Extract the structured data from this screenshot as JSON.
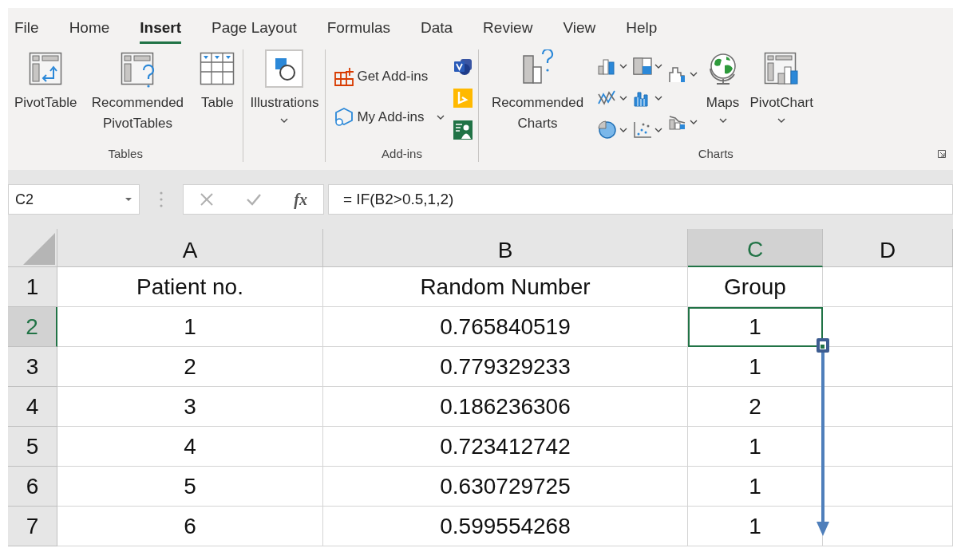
{
  "menu_tabs": [
    {
      "label": "File",
      "selected": false
    },
    {
      "label": "Home",
      "selected": false
    },
    {
      "label": "Insert",
      "selected": true
    },
    {
      "label": "Page Layout",
      "selected": false
    },
    {
      "label": "Formulas",
      "selected": false
    },
    {
      "label": "Data",
      "selected": false
    },
    {
      "label": "Review",
      "selected": false
    },
    {
      "label": "View",
      "selected": false
    },
    {
      "label": "Help",
      "selected": false
    }
  ],
  "ribbon_groups": [
    {
      "label": "Tables",
      "items": [
        {
          "kind": "large",
          "label": "PivotTable",
          "dropdown": false
        },
        {
          "kind": "large",
          "label": "Recommended PivotTables",
          "dropdown": false
        },
        {
          "kind": "large",
          "label": "Table",
          "dropdown": false
        }
      ]
    },
    {
      "items": [
        {
          "kind": "large",
          "label": "Illustrations",
          "dropdown": true
        }
      ]
    },
    {
      "label": "Add-ins",
      "items": [
        {
          "kind": "medium",
          "label": "Get Add-ins",
          "dropdown": false
        },
        {
          "kind": "medium",
          "label": "My Add-ins",
          "dropdown": true
        },
        {
          "kind": "small",
          "dropdown": false
        },
        {
          "kind": "small",
          "dropdown": false
        },
        {
          "kind": "small",
          "dropdown": false
        }
      ]
    },
    {
      "label": "Charts",
      "dialog_launcher": true,
      "items": [
        {
          "kind": "large",
          "label": "Recommended Charts",
          "dropdown": false
        },
        {
          "kind": "small",
          "dropdown": true
        },
        {
          "kind": "small",
          "dropdown": true
        },
        {
          "kind": "small",
          "dropdown": true
        },
        {
          "kind": "small",
          "dropdown": true
        },
        {
          "kind": "small",
          "dropdown": true
        },
        {
          "kind": "small",
          "dropdown": true
        },
        {
          "kind": "small",
          "dropdown": true
        },
        {
          "kind": "small",
          "dropdown": true
        },
        {
          "kind": "large",
          "label": "Maps",
          "dropdown": true
        },
        {
          "kind": "large",
          "label": "PivotChart",
          "dropdown": true
        }
      ]
    }
  ],
  "formula_bar": {
    "name_box": "C2",
    "function_button": "fx",
    "formula": "= IF(B2>0.5,1,2)"
  },
  "sheet": {
    "columns": [
      {
        "label": "A",
        "selected": false
      },
      {
        "label": "B",
        "selected": false
      },
      {
        "label": "C",
        "selected": true
      },
      {
        "label": "D",
        "selected": false
      }
    ],
    "rows": [
      {
        "number": "1",
        "selected": false,
        "cells": [
          "Patient no.",
          "Random Number",
          "Group"
        ]
      },
      {
        "number": "2",
        "selected": true,
        "cells": [
          "1",
          "0.765840519",
          "1"
        ]
      },
      {
        "number": "3",
        "selected": false,
        "cells": [
          "2",
          "0.779329233",
          "1"
        ]
      },
      {
        "number": "4",
        "selected": false,
        "cells": [
          "3",
          "0.186236306",
          "2"
        ]
      },
      {
        "number": "5",
        "selected": false,
        "cells": [
          "4",
          "0.723412742",
          "1"
        ]
      },
      {
        "number": "6",
        "selected": false,
        "cells": [
          "5",
          "0.630729725",
          "1"
        ]
      },
      {
        "number": "7",
        "selected": false,
        "cells": [
          "6",
          "0.599554268",
          "1"
        ]
      }
    ]
  }
}
